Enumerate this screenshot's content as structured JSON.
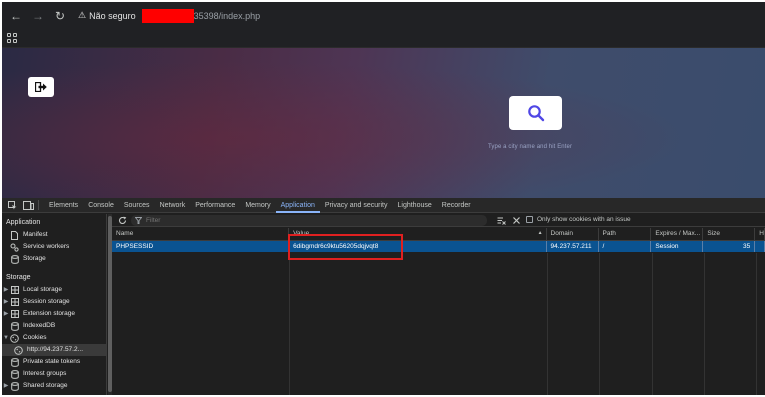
{
  "browser": {
    "nav": {
      "back_icon": "←",
      "forward_icon": "→",
      "reload_icon": "↻"
    },
    "address": {
      "warning_icon": "⚠",
      "insecure_label": "Não seguro",
      "url_suffix": "35398/index.php",
      "redaction_color": "#ff0000"
    }
  },
  "page": {
    "city_hint": "Type a city name and hit Enter",
    "accent": "#4f46e5"
  },
  "devtools": {
    "tabs": [
      "Elements",
      "Console",
      "Sources",
      "Network",
      "Performance",
      "Memory",
      "Application",
      "Privacy and security",
      "Lighthouse",
      "Recorder"
    ],
    "active_tab": "Application",
    "sidebar": {
      "application_heading": "Application",
      "application_items": [
        "Manifest",
        "Service workers",
        "Storage"
      ],
      "storage_heading": "Storage",
      "storage_items": [
        "Local storage",
        "Session storage",
        "Extension storage",
        "IndexedDB",
        "Cookies",
        "http://94.237.57.2...",
        "Private state tokens",
        "Interest groups",
        "Shared storage"
      ]
    },
    "toolbar": {
      "filter_placeholder": "Filter",
      "only_issues_label": "Only show cookies with an issue"
    },
    "cookies_table": {
      "columns": [
        "Name",
        "Value",
        "Domain",
        "Path",
        "Expires / Max...",
        "Size",
        "H"
      ],
      "rows": [
        {
          "name": "PHPSESSID",
          "value": "6dibgmdr6c9ktu56205dqjvqt8",
          "domain": "94.237.57.211",
          "path": "/",
          "expires": "Session",
          "size": "35",
          "http": ""
        }
      ]
    },
    "highlight_color": "#e02020",
    "selection_color": "#0a5391"
  }
}
